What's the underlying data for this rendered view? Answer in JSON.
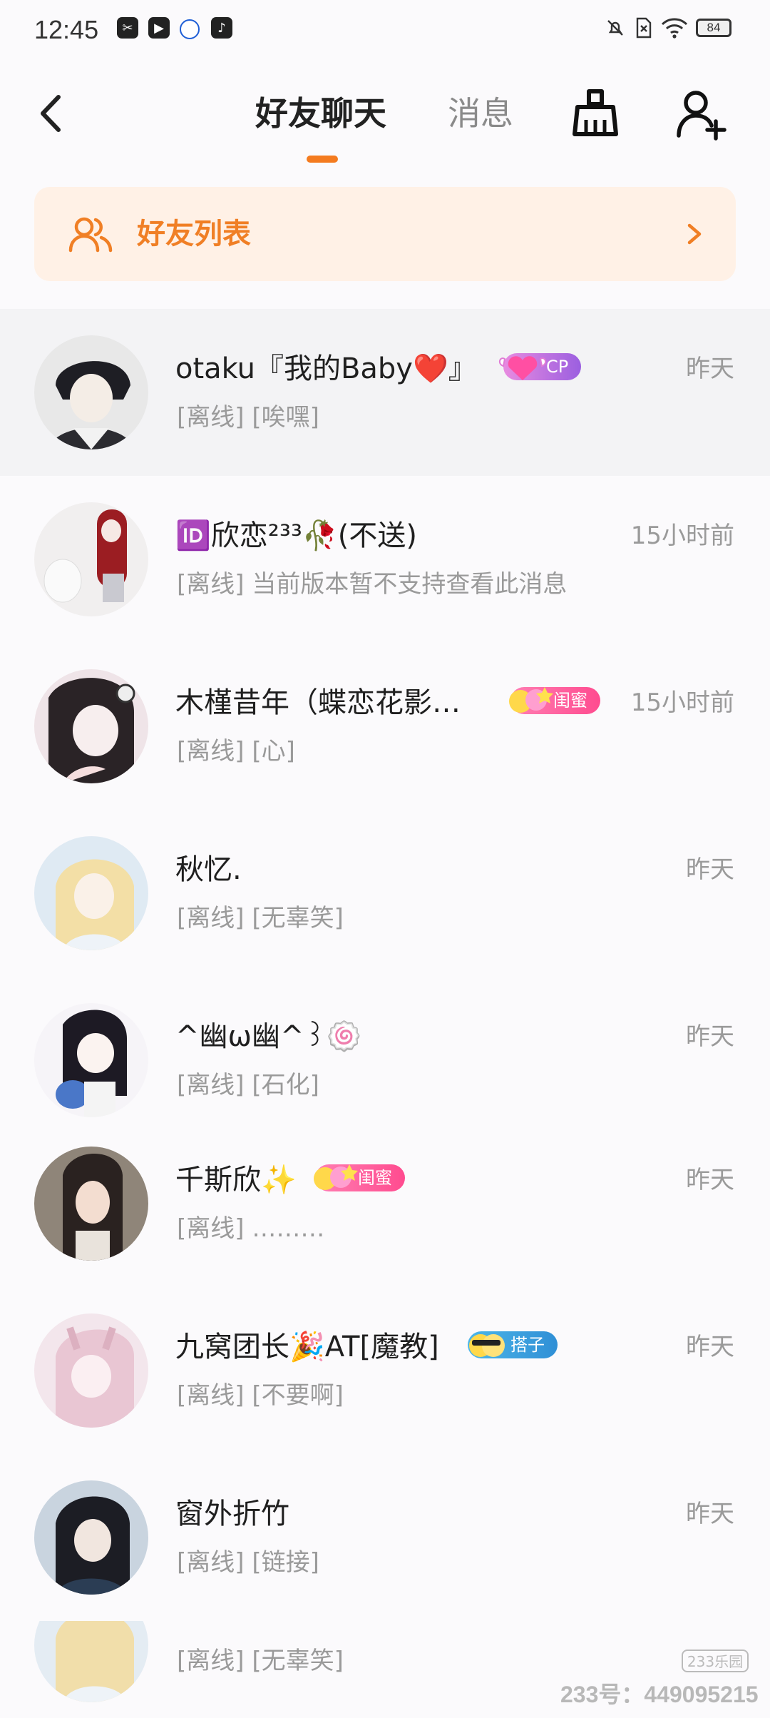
{
  "status_bar": {
    "time": "12:45",
    "battery": "84",
    "left_icons": [
      "gallery-app-icon",
      "video-app-icon",
      "circle-app-icon",
      "tiktok-icon"
    ],
    "right_icons": [
      "mute-icon",
      "sim-off-icon",
      "wifi-icon"
    ]
  },
  "header": {
    "tab_friends_chat": "好友聊天",
    "tab_messages": "消息",
    "icons": [
      "back-icon",
      "clear-broom-icon",
      "add-friend-icon"
    ],
    "accent_color": "#f47b1f"
  },
  "friend_banner": {
    "label": "好友列表"
  },
  "conversations": [
    {
      "name": "otaku『我的Baby❤️』",
      "badge": "CP",
      "time": "昨天",
      "status": "[离线]",
      "preview": "[唉嘿]"
    },
    {
      "name": "🆔欣恋²³³🥀(不送)",
      "badge": "",
      "time": "15小时前",
      "status": "[离线]",
      "preview": "当前版本暂不支持查看此消息"
    },
    {
      "name": "木槿昔年（蝶恋花影…",
      "badge": "闺蜜",
      "time": "15小时前",
      "status": "[离线]",
      "preview": "[心]"
    },
    {
      "name": "秋忆.",
      "badge": "",
      "time": "昨天",
      "status": "[离线]",
      "preview": "[无辜笑]"
    },
    {
      "name": "^幽ω幽^꒱🍥",
      "badge": "",
      "time": "昨天",
      "status": "[离线]",
      "preview": "[石化]"
    },
    {
      "name": "千斯欣✨",
      "badge": "闺蜜",
      "time": "昨天",
      "status": "[离线]",
      "preview": "………"
    },
    {
      "name": "九窝团长🎉AT[魔教]",
      "badge": "搭子",
      "time": "昨天",
      "status": "[离线]",
      "preview": "[不要啊]"
    },
    {
      "name": "窗外折竹",
      "badge": "",
      "time": "昨天",
      "status": "[离线]",
      "preview": "[链接]"
    },
    {
      "name": "",
      "badge": "",
      "time": "",
      "status": "[离线]",
      "preview": "[无辜笑]"
    }
  ],
  "watermark": {
    "brand": "233乐园",
    "id_text": "233号：449095215"
  }
}
